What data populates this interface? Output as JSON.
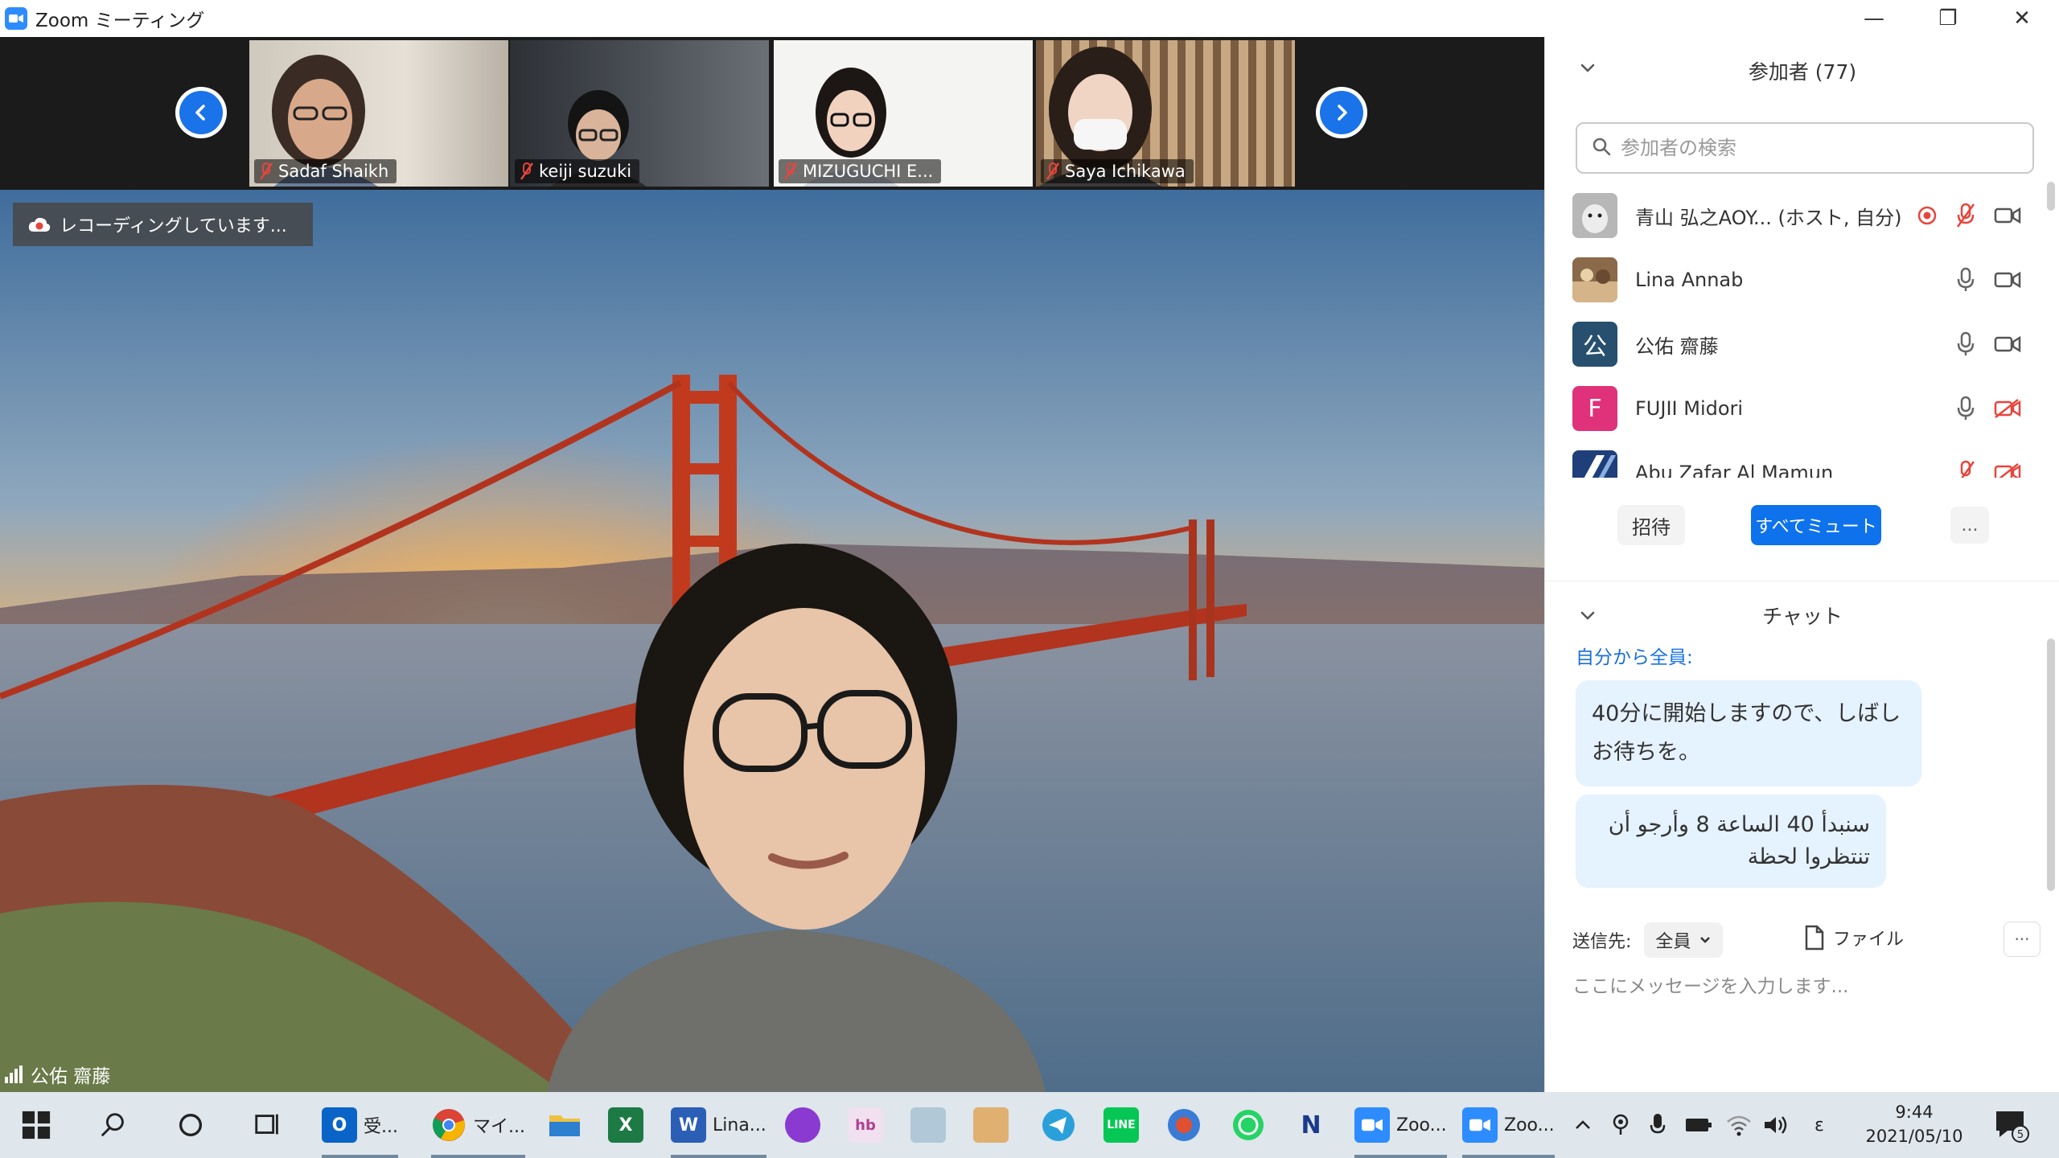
{
  "window": {
    "title": "Zoom ミーティング",
    "minimize": "—",
    "restore": "❐",
    "close": "✕"
  },
  "thumbnails": [
    {
      "name": "Sadaf Shaikh",
      "bg": "#d8d2c8",
      "skin": "#d8a88a",
      "hair": "#3a2c24"
    },
    {
      "name": "keiji suzuki",
      "bg": "#3d4148",
      "skin": "#d9b49a",
      "hair": "#141414"
    },
    {
      "name": "MIZUGUCHI E...",
      "bg": "#f4f4f2",
      "skin": "#f1d2bf",
      "hair": "#1c1614"
    },
    {
      "name": "Saya Ichikawa",
      "bg": "#9b7a5a",
      "skin": "#f0d5c4",
      "hair": "#2a1e18"
    }
  ],
  "recording": {
    "label": "レコーディングしています..."
  },
  "speaker": {
    "name": "公佑 齋藤"
  },
  "participants": {
    "title": "参加者 (77)",
    "search_placeholder": "参加者の検索",
    "list": [
      {
        "name": "青山 弘之AOY...  (ホスト, 自分)",
        "avatar_color": "#8a8a8a",
        "initial": "",
        "mic_muted": true,
        "cam_off": false,
        "recording": true
      },
      {
        "name": "Lina Annab",
        "avatar_color": "#9a7a55",
        "initial": "",
        "mic_muted": false,
        "cam_off": false,
        "recording": false
      },
      {
        "name": "公佑 齋藤",
        "avatar_color": "#26506e",
        "initial": "公",
        "mic_muted": false,
        "cam_off": false,
        "recording": false
      },
      {
        "name": "FUJII Midori",
        "avatar_color": "#e0327a",
        "initial": "F",
        "mic_muted": false,
        "cam_off": true,
        "recording": false
      },
      {
        "name": "Abu Zafar Al Mamun",
        "avatar_color": "#1f4a8a",
        "initial": "",
        "mic_muted": true,
        "cam_off": true,
        "recording": false
      }
    ],
    "invite_label": "招待",
    "mute_all_label": "すべてミュート",
    "more_label": "..."
  },
  "chat": {
    "title": "チャット",
    "from_prefix": "自分から",
    "from_to": "全員:",
    "messages": [
      "40分に開始しますので、しばしお待ちを。",
      "سنبدأ 40 الساعة 8 وأرجو أن تنتظروا لحظة"
    ],
    "send_to_label": "送信先:",
    "send_to_value": "全員",
    "file_label": "ファイル",
    "more_label": "···",
    "input_placeholder": "ここにメッセージを入力します..."
  },
  "taskbar": {
    "items": [
      {
        "id": "outlook",
        "label": "受..."
      },
      {
        "id": "chrome",
        "label": "マイ..."
      },
      {
        "id": "word",
        "label": "Lina..."
      },
      {
        "id": "zoom1",
        "label": "Zoo..."
      },
      {
        "id": "zoom2",
        "label": "Zoo..."
      }
    ],
    "time": "9:44",
    "date": "2021/05/10",
    "ime": "ε",
    "notif_count": "5"
  },
  "colors": {
    "accent": "#0e72ed",
    "zoom_blue": "#2d8cff",
    "bubble": "#e5f2ff",
    "muted_red": "#e8453c"
  }
}
